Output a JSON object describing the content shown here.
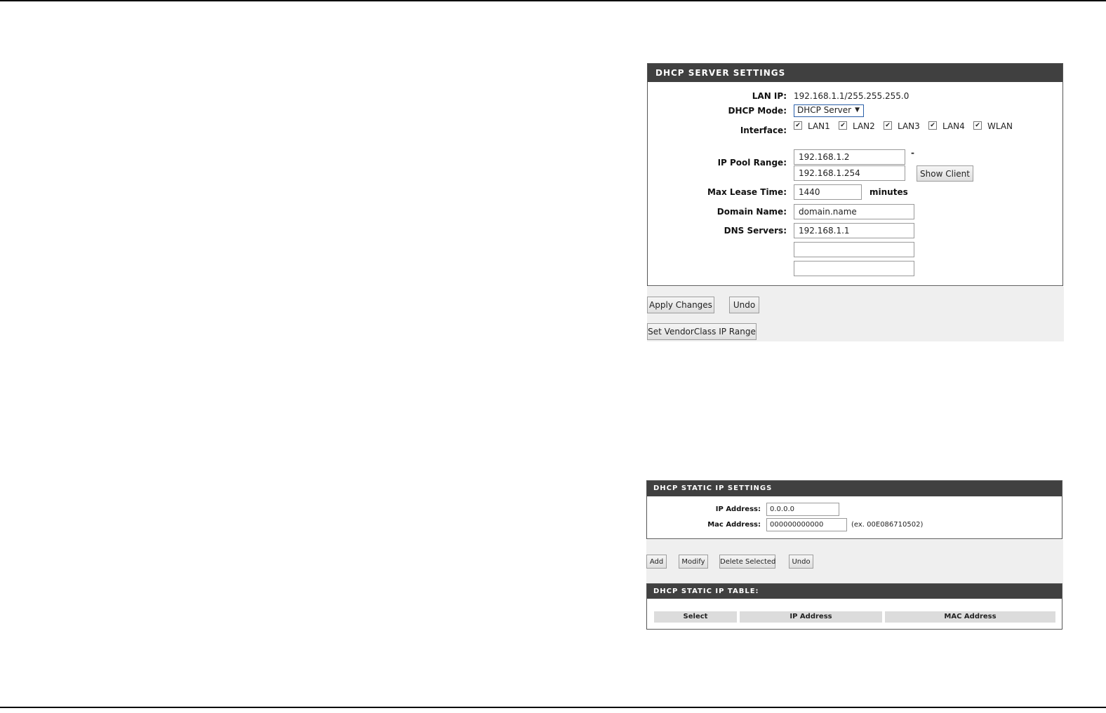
{
  "server_settings": {
    "header": "DHCP SERVER SETTINGS",
    "lan_ip_label": "LAN IP:",
    "lan_ip_value": "192.168.1.1/255.255.255.0",
    "dhcp_mode_label": "DHCP Mode:",
    "dhcp_mode_value": "DHCP Server",
    "interface_label": "Interface:",
    "interfaces": [
      {
        "label": "LAN1",
        "checked": true
      },
      {
        "label": "LAN2",
        "checked": true
      },
      {
        "label": "LAN3",
        "checked": true
      },
      {
        "label": "LAN4",
        "checked": true
      },
      {
        "label": "WLAN",
        "checked": true
      }
    ],
    "ip_pool_label": "IP Pool Range:",
    "ip_pool_start": "192.168.1.2",
    "ip_pool_dash": "-",
    "ip_pool_end": "192.168.1.254",
    "show_client_label": "Show Client",
    "max_lease_label": "Max Lease Time:",
    "max_lease_value": "1440",
    "minutes_label": "minutes",
    "domain_name_label": "Domain Name:",
    "domain_name_value": "domain.name",
    "dns_servers_label": "DNS Servers:",
    "dns_server_1": "192.168.1.1",
    "dns_server_2": "",
    "dns_server_3": "",
    "apply_label": "Apply Changes",
    "undo_label": "Undo",
    "vendor_class_label": "Set VendorClass IP Range"
  },
  "static_settings": {
    "header": "DHCP STATIC IP SETTINGS",
    "ip_address_label": "IP Address:",
    "ip_address_value": "0.0.0.0",
    "mac_address_label": "Mac Address:",
    "mac_address_value": "000000000000",
    "mac_example": "(ex. 00E086710502)",
    "add_label": "Add",
    "modify_label": "Modify",
    "delete_selected_label": "Delete Selected",
    "undo_label": "Undo"
  },
  "static_table": {
    "header": "DHCP STATIC IP TABLE:",
    "columns": [
      "Select",
      "IP Address",
      "MAC Address"
    ]
  }
}
